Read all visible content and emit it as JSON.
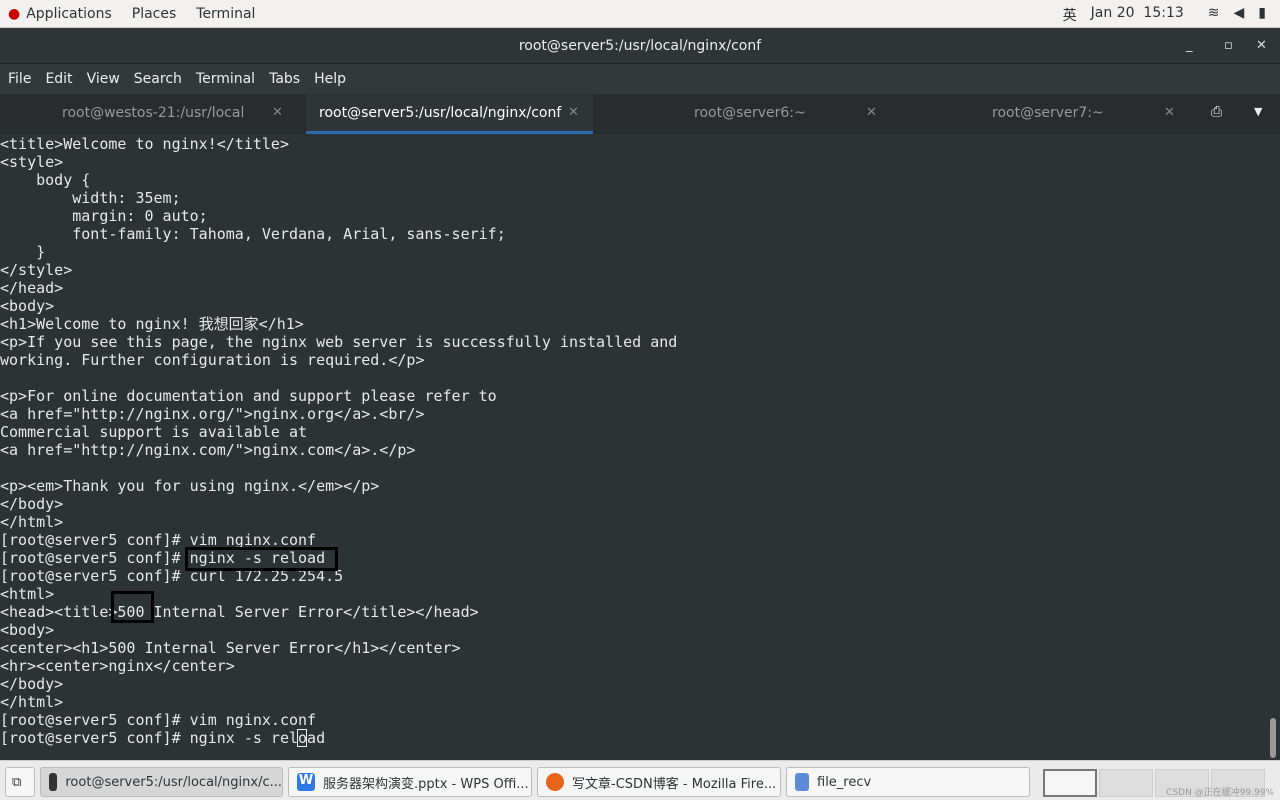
{
  "topbar": {
    "applications": "Applications",
    "places": "Places",
    "terminal": "Terminal",
    "input_method": "英",
    "datetime": "Jan 20  15:13"
  },
  "window": {
    "title": "root@server5:/usr/local/nginx/conf"
  },
  "menu": [
    "File",
    "Edit",
    "View",
    "Search",
    "Terminal",
    "Tabs",
    "Help"
  ],
  "tabs": [
    {
      "label": "root@westos-21:/usr/local"
    },
    {
      "label": "root@server5:/usr/local/nginx/conf"
    },
    {
      "label": "root@server6:~"
    },
    {
      "label": "root@server7:~"
    }
  ],
  "terminal_text": "<title>Welcome to nginx!</title>\n<style>\n    body {\n        width: 35em;\n        margin: 0 auto;\n        font-family: Tahoma, Verdana, Arial, sans-serif;\n    }\n</style>\n</head>\n<body>\n<h1>Welcome to nginx! 我想回家</h1>\n<p>If you see this page, the nginx web server is successfully installed and\nworking. Further configuration is required.</p>\n\n<p>For online documentation and support please refer to\n<a href=\"http://nginx.org/\">nginx.org</a>.<br/>\nCommercial support is available at\n<a href=\"http://nginx.com/\">nginx.com</a>.</p>\n\n<p><em>Thank you for using nginx.</em></p>\n</body>\n</html>\n[root@server5 conf]# vim nginx.conf\n[root@server5 conf]# nginx -s reload\n[root@server5 conf]# curl 172.25.254.5\n<html>\n<head><title>500 Internal Server Error</title></head>\n<body>\n<center><h1>500 Internal Server Error</h1></center>\n<hr><center>nginx</center>\n</body>\n</html>\n[root@server5 conf]# vim nginx.conf\n[root@server5 conf]# nginx -s reload",
  "taskbar": [
    {
      "label": "root@server5:/usr/local/nginx/c..."
    },
    {
      "label": "服务器架构演变.pptx - WPS Offi..."
    },
    {
      "label": "写文章-CSDN博客 - Mozilla Fire..."
    },
    {
      "label": "file_recv"
    }
  ],
  "watermark": "CSDN @正在缓冲99.99%"
}
